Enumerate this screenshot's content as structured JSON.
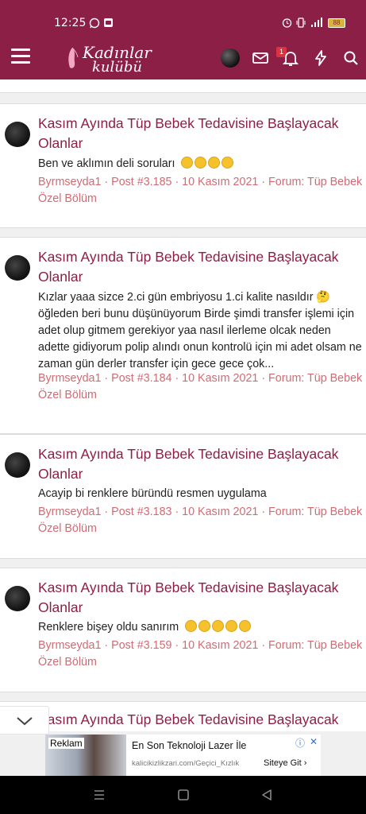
{
  "status_bar": {
    "time": "12:25",
    "battery": "88"
  },
  "header": {
    "logo_line1": "Kadınlar",
    "logo_line2": "kulübü",
    "alerts_badge": "1"
  },
  "posts": [
    {
      "title": "Kasım Ayında Tüp Bebek Tedavisine Başlayacak Olanlar",
      "body": "Ben ve aklımın deli soruları",
      "emoji_count": 4,
      "meta_line1": "Byrmseyda1 · Post #3.185 · 10 Kasım 2021 · Forum: Tüp Bebek",
      "meta_line2": "Özel Bölüm"
    },
    {
      "title": "Kasım Ayında Tüp Bebek Tedavisine Başlayacak Olanlar",
      "body": "Kızlar yaaa sizce 2.ci gün embriyosu 1.ci kalite nasıldır 🤔 öğleden beri bunu düşünüyorum Birde şimdi transfer işlemi için adet olup gitmem gerekiyor yaa nasıl ilerleme olcak neden adette gidiyorum polip alındı onun kontrolü için mi adet olsam ne zaman gün derler transfer için gece gece çok...",
      "meta_line1": "Byrmseyda1 · Post #3.184 · 10 Kasım 2021 · Forum: Tüp Bebek",
      "meta_line2": "Özel Bölüm"
    },
    {
      "title": "Kasım Ayında Tüp Bebek Tedavisine Başlayacak Olanlar",
      "body": "Acayip bi renklere büründü resmen uygulama",
      "meta_line1": "Byrmseyda1 · Post #3.183 · 10 Kasım 2021 · Forum: Tüp Bebek",
      "meta_line2": "Özel Bölüm"
    },
    {
      "title": "Kasım Ayında Tüp Bebek Tedavisine Başlayacak Olanlar",
      "body": "Renklere bişey oldu sanırım",
      "emoji_count": 5,
      "meta_line1": "Byrmseyda1 · Post #3.159 · 10 Kasım 2021 · Forum: Tüp Bebek",
      "meta_line2": "Özel Bölüm"
    },
    {
      "title": "Kasım Ayında Tüp Bebek Tedavisine Başlayacak"
    }
  ],
  "ad": {
    "label": "Reklam",
    "headline": "En Son Teknoloji Lazer İle",
    "url": "kalicikizlikzari.com/Geçici_Kızlık",
    "cta": "Siteye Git",
    "info_icon": "ⓘ",
    "close_icon": "✕"
  },
  "colors": {
    "brand": "#8c1f45",
    "meta": "#d26a73"
  }
}
